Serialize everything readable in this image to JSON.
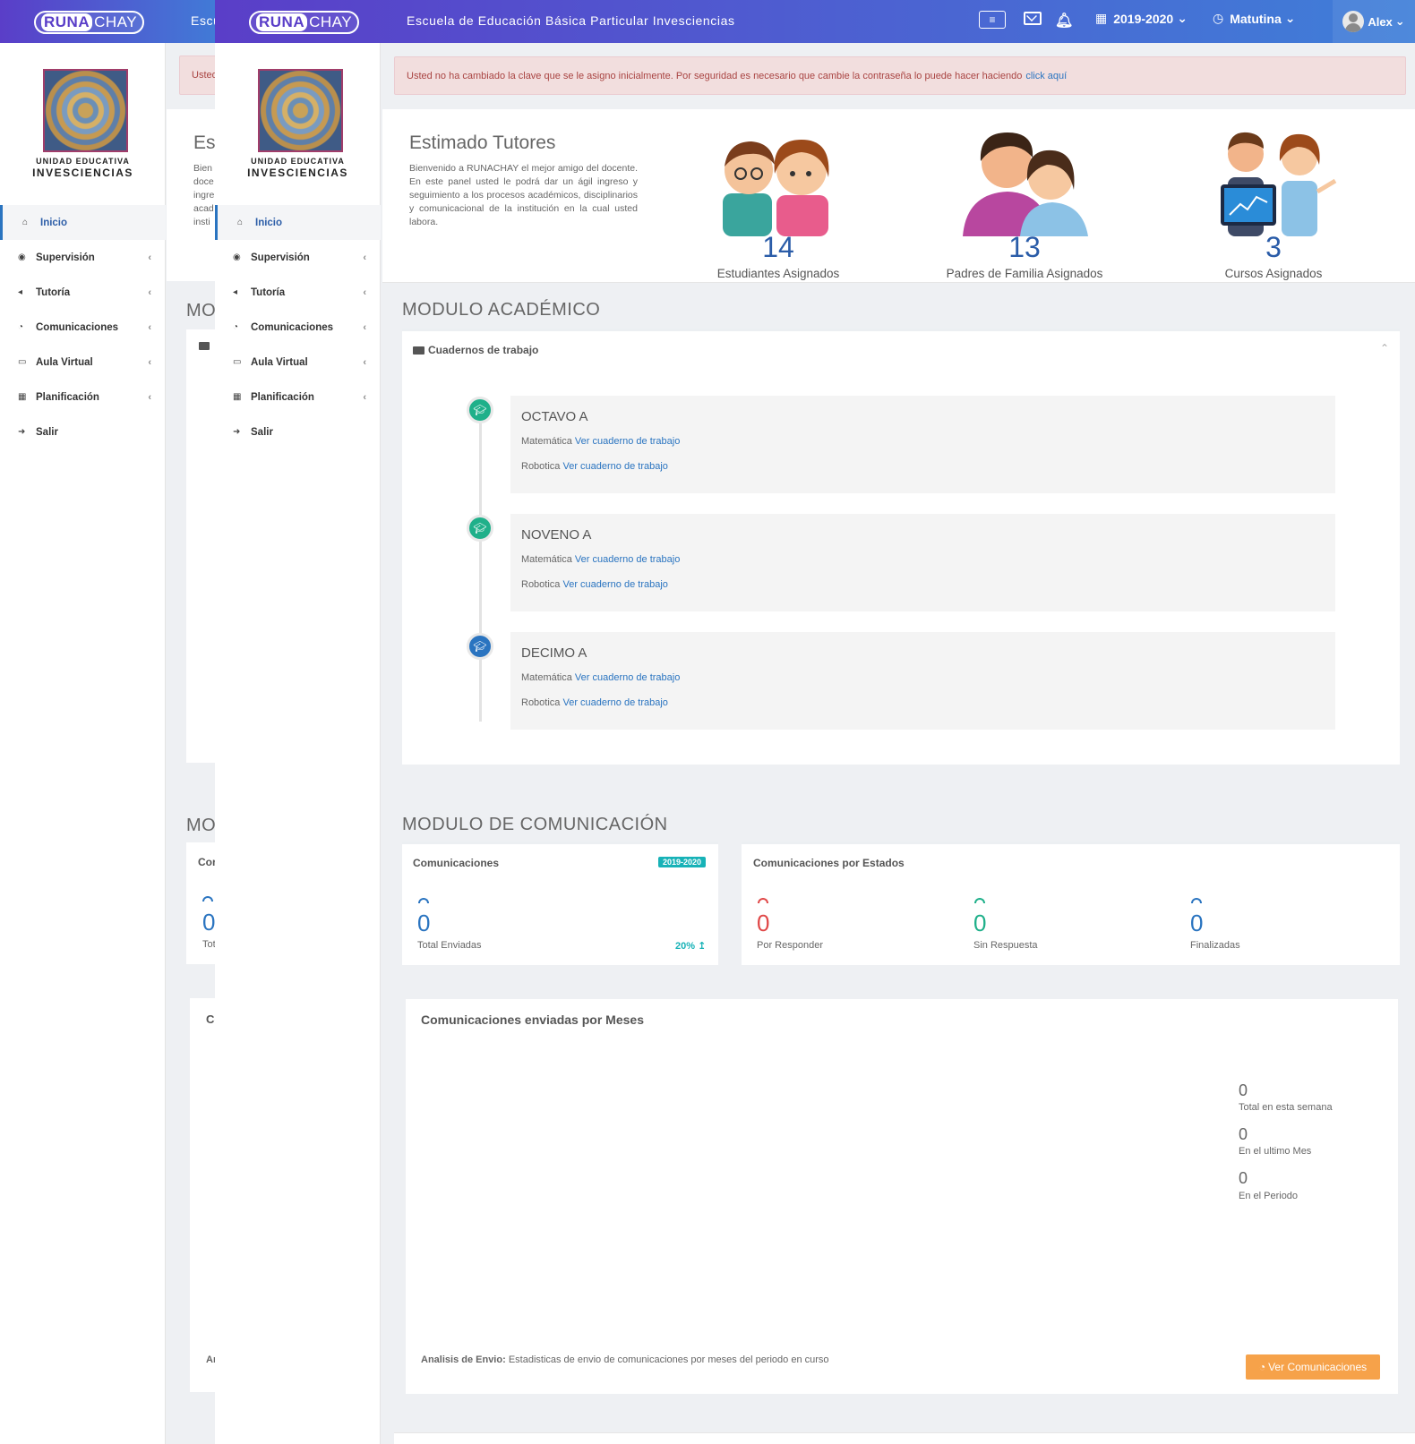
{
  "app": {
    "logo_runa": "RUNA",
    "logo_chay": "CHAY",
    "school_name": "Escuela de Educación Básica Particular Invesciencias",
    "school_name_cut": "Escu",
    "period": "2019-2020",
    "shift": "Matutina",
    "user": "Alex"
  },
  "sidebar": {
    "logo_line1": "UNIDAD EDUCATIVA",
    "logo_line2": "INVESCIENCIAS",
    "items": [
      {
        "label": "Inicio",
        "icon": "home-icon"
      },
      {
        "label": "Supervisión",
        "icon": "eye-icon"
      },
      {
        "label": "Tutoría",
        "icon": "megaphone-icon"
      },
      {
        "label": "Comunicaciones",
        "icon": "chat-icon"
      },
      {
        "label": "Aula Virtual",
        "icon": "laptop-icon"
      },
      {
        "label": "Planificación",
        "icon": "calendar-icon"
      },
      {
        "label": "Salir",
        "icon": "sign-out-icon"
      }
    ]
  },
  "alert": {
    "text": "Usted no ha cambiado la clave que se le asigno inicialmente. Por seguridad es necesario que cambie la contraseña lo puede hacer haciendo",
    "link": "click aquí",
    "text_cut": "Usted"
  },
  "welcome": {
    "title": "Estimado Tutores",
    "title_cut": "Es",
    "body": "Bienvenido a RUNACHAY el mejor amigo del docente. En este panel usted le podrá dar un ágil ingreso y seguimiento a los procesos académicos, disciplinarios y comunicacional de la institución en la cual usted labora.",
    "body_cut": [
      "Bien",
      "doce",
      "ingre",
      "acad",
      "insti"
    ]
  },
  "stats": [
    {
      "value": "14",
      "label": "Estudiantes Asignados"
    },
    {
      "value": "13",
      "label": "Padres de Familia Asignados"
    },
    {
      "value": "3",
      "label": "Cursos Asignados"
    }
  ],
  "academic": {
    "title": "MODULO ACADÉMICO",
    "title_cut": "MO",
    "card_title": "Cuadernos de trabajo",
    "courses": [
      {
        "name": "OCTAVO A",
        "color": "#1fb08a",
        "rows": [
          {
            "subject": "Matemática",
            "link": "Ver cuaderno de trabajo"
          },
          {
            "subject": "Robotica",
            "link": "Ver cuaderno de trabajo"
          }
        ]
      },
      {
        "name": "NOVENO A",
        "color": "#1fb08a",
        "rows": [
          {
            "subject": "Matemática",
            "link": "Ver cuaderno de trabajo"
          },
          {
            "subject": "Robotica",
            "link": "Ver cuaderno de trabajo"
          }
        ]
      },
      {
        "name": "DECIMO A",
        "color": "#2a74c0",
        "rows": [
          {
            "subject": "Matemática",
            "link": "Ver cuaderno de trabajo"
          },
          {
            "subject": "Robotica",
            "link": "Ver cuaderno de trabajo"
          }
        ]
      }
    ]
  },
  "comms": {
    "title": "MODULO DE COMUNICACIÓN",
    "title_cut": "MO",
    "card1": {
      "title": "Comunicaciones",
      "title_cut": "Cor",
      "badge": "2019-2020",
      "value": "0",
      "label": "Total Enviadas",
      "label_cut": "Tot",
      "pct": "20%",
      "color": "#2a74c0",
      "pct_color": "#17b2b7"
    },
    "card2": {
      "title": "Comunicaciones por Estados",
      "items": [
        {
          "value": "0",
          "label": "Por Responder",
          "color": "#e04848"
        },
        {
          "value": "0",
          "label": "Sin Respuesta",
          "color": "#1fb08a"
        },
        {
          "value": "0",
          "label": "Finalizadas",
          "color": "#2a74c0"
        }
      ]
    },
    "monthly": {
      "title": "Comunicaciones enviadas por Meses",
      "title_cut": "Co",
      "side": [
        {
          "value": "0",
          "label": "Total en esta semana"
        },
        {
          "value": "0",
          "label": "En el ultimo Mes"
        },
        {
          "value": "0",
          "label": "En el Periodo"
        }
      ],
      "analysis_label": "Analisis de Envio:",
      "analysis_text": "Estadisticas de envio de comunicaciones por meses del periodo en curso",
      "analysis_cut": "An",
      "button": "Ver Comunicaciones"
    }
  }
}
